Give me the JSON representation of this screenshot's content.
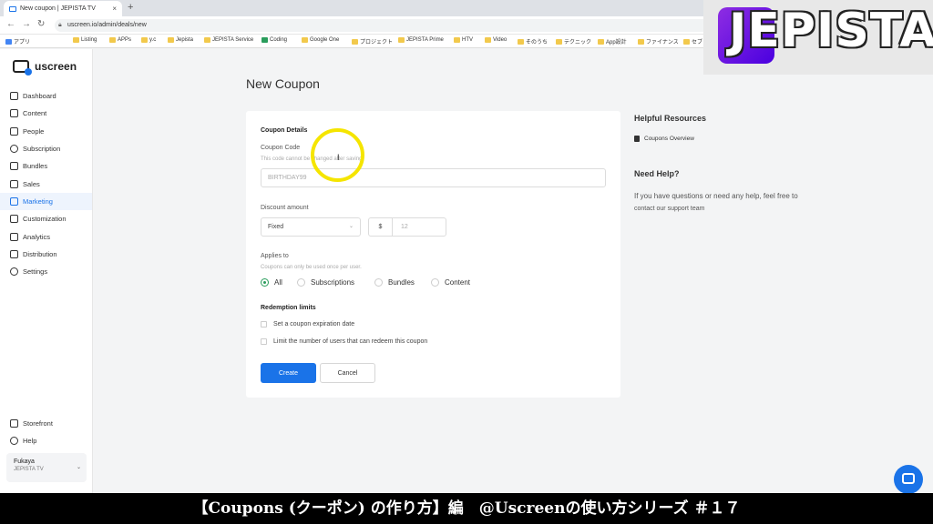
{
  "browser": {
    "tab_title": "New coupon | JEPISTA TV",
    "tab_close": "×",
    "new_tab": "+",
    "url": "uscreen.io/admin/deals/new",
    "win_min": "−",
    "win_max": "❐",
    "win_close": "✕",
    "bookmarks": [
      "アプリ",
      "Listing",
      "APPs",
      "y.c",
      "Jepista",
      "JEPISTA Service",
      "Coding",
      "Google One",
      "プロジェクト",
      "JEPISTA Prime",
      "HTV",
      "Video",
      "そのうち",
      "テクニック",
      "App設計",
      "ファイナンス",
      "セブ"
    ]
  },
  "overlay": {
    "logo_text": "JEPISTA",
    "caption": "【Coupons (クーポン) の作り方】編　@Uscreenの使い方シリーズ ＃１７"
  },
  "sidebar": {
    "brand": "uscreen",
    "items": [
      {
        "label": "Dashboard",
        "icon": "dashboard-icon"
      },
      {
        "label": "Content",
        "icon": "folder-icon"
      },
      {
        "label": "People",
        "icon": "people-icon"
      },
      {
        "label": "Subscription",
        "icon": "refresh-icon"
      },
      {
        "label": "Bundles",
        "icon": "box-icon"
      },
      {
        "label": "Sales",
        "icon": "tag-icon"
      },
      {
        "label": "Marketing",
        "icon": "megaphone-icon"
      },
      {
        "label": "Customization",
        "icon": "edit-icon"
      },
      {
        "label": "Analytics",
        "icon": "chart-icon"
      },
      {
        "label": "Distribution",
        "icon": "share-icon"
      },
      {
        "label": "Settings",
        "icon": "gear-icon"
      }
    ],
    "bottom": [
      {
        "label": "Storefront",
        "icon": "store-icon"
      },
      {
        "label": "Help",
        "icon": "help-icon"
      }
    ],
    "account": {
      "name": "Fukaya",
      "org": "JEPISTA TV",
      "chevron": "⌄"
    }
  },
  "main": {
    "page_title": "New Coupon",
    "details_title": "Coupon Details",
    "code_label": "Coupon Code",
    "code_help": "This code cannot be changed after saving.",
    "code_placeholder": "BIRTHDAY99",
    "discount_label": "Discount amount",
    "discount_type": "Fixed",
    "currency": "$",
    "amount_placeholder": "12",
    "applies_label": "Applies to",
    "applies_help": "Coupons can only be used once per user.",
    "applies_options": [
      "All",
      "Subscriptions",
      "Bundles",
      "Content"
    ],
    "applies_selected": "All",
    "redemption_title": "Redemption limits",
    "redemption_options": [
      "Set a coupon expiration date",
      "Limit the number of users that can redeem this coupon"
    ],
    "create_label": "Create",
    "cancel_label": "Cancel"
  },
  "right": {
    "resources_title": "Helpful Resources",
    "resource_link": "Coupons Overview",
    "help_title": "Need Help?",
    "help_text": "If you have questions or need any help, feel free to",
    "help_link": "contact our support team"
  },
  "colors": {
    "accent": "#1a73e8",
    "selected_radio": "#2a9d5c",
    "highlight_ring": "#f5e500"
  }
}
